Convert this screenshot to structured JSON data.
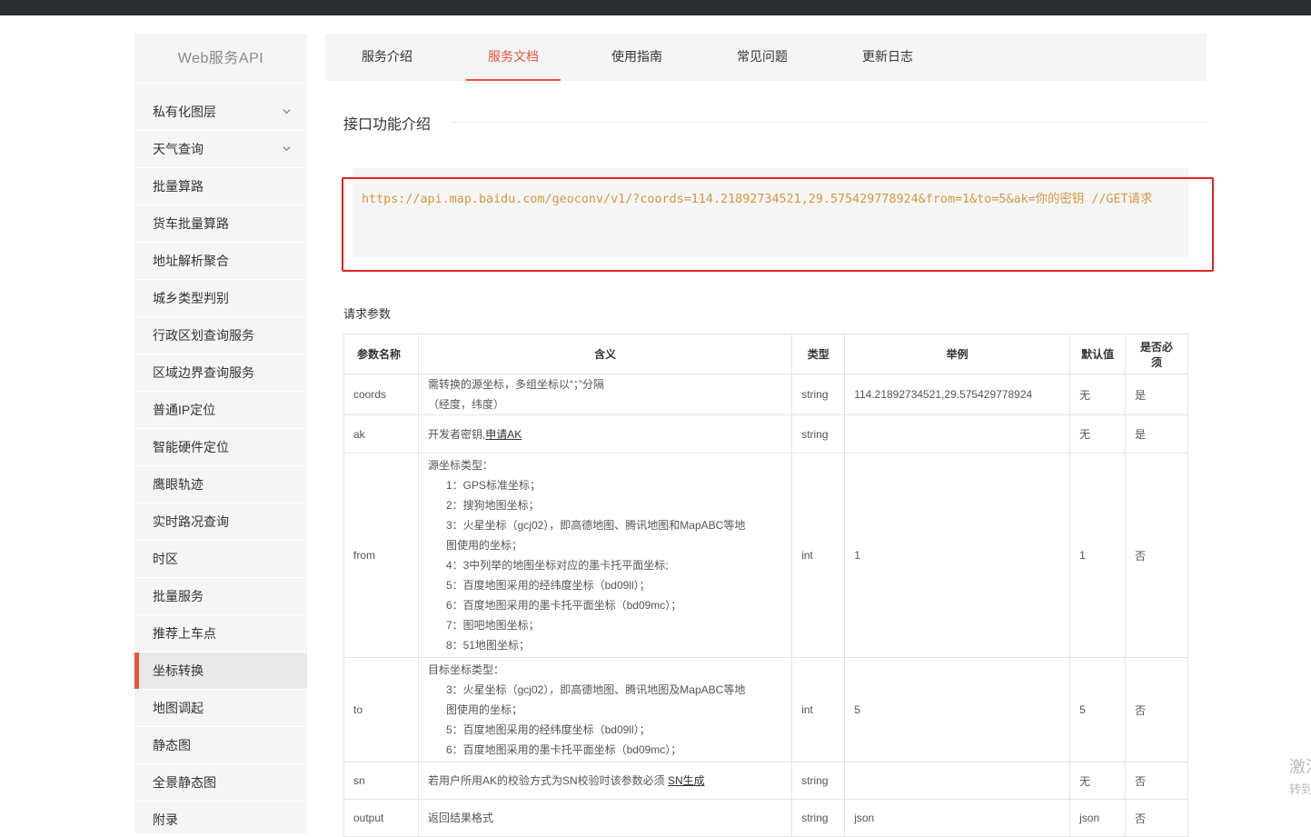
{
  "sidebar": {
    "title": "Web服务API",
    "items": [
      {
        "label": "私有化图层",
        "expandable": true
      },
      {
        "label": "天气查询",
        "expandable": true
      },
      {
        "label": "批量算路"
      },
      {
        "label": "货车批量算路"
      },
      {
        "label": "地址解析聚合"
      },
      {
        "label": "城乡类型判别"
      },
      {
        "label": "行政区划查询服务"
      },
      {
        "label": "区域边界查询服务"
      },
      {
        "label": "普通IP定位"
      },
      {
        "label": "智能硬件定位"
      },
      {
        "label": "鹰眼轨迹"
      },
      {
        "label": "实时路况查询"
      },
      {
        "label": "时区"
      },
      {
        "label": "批量服务"
      },
      {
        "label": "推荐上车点"
      },
      {
        "label": "坐标转换",
        "active": true
      },
      {
        "label": "地图调起"
      },
      {
        "label": "静态图"
      },
      {
        "label": "全景静态图"
      },
      {
        "label": "附录"
      }
    ],
    "active_color": "#e8533d"
  },
  "tabs": [
    {
      "label": "服务介绍"
    },
    {
      "label": "服务文档",
      "active": true
    },
    {
      "label": "使用指南"
    },
    {
      "label": "常见问题"
    },
    {
      "label": "更新日志"
    }
  ],
  "section": {
    "title": "接口功能介绍",
    "code": "https://api.map.baidu.com/geoconv/v1/?coords=114.21892734521,29.575429778924&from=1&to=5&ak=你的密钥 //GET请求"
  },
  "params": {
    "title": "请求参数",
    "headers": [
      "参数名称",
      "含义",
      "类型",
      "举例",
      "默认值",
      "是否必须"
    ],
    "rows": [
      {
        "name": "coords",
        "meaning": [
          "需转换的源坐标，多组坐标以“；”分隔",
          "（经度，纬度）"
        ],
        "type": "string",
        "example": "114.21892734521,29.575429778924",
        "default": "无",
        "required": "是"
      },
      {
        "name": "ak",
        "meaning_text": "开发者密钥,",
        "meaning_link": "申请AK",
        "type": "string",
        "example": "",
        "default": "无",
        "required": "是"
      },
      {
        "name": "from",
        "meaning_head": "源坐标类型：",
        "meaning": [
          "1：GPS标准坐标；",
          "2：搜狗地图坐标；",
          "3：火星坐标（gcj02），即高德地图、腾讯地图和MapABC等地",
          "图使用的坐标；",
          "4：3中列举的地图坐标对应的墨卡托平面坐标;",
          "5：百度地图采用的经纬度坐标（bd09ll）；",
          "6：百度地图采用的墨卡托平面坐标（bd09mc）；",
          "7：图吧地图坐标；",
          "8：51地图坐标；"
        ],
        "type": "int",
        "example": "1",
        "default": "1",
        "required": "否"
      },
      {
        "name": "to",
        "meaning_head": "目标坐标类型：",
        "meaning": [
          "3：火星坐标（gcj02），即高德地图、腾讯地图及MapABC等地",
          "图使用的坐标；",
          "5：百度地图采用的经纬度坐标（bd09ll）；",
          "6：百度地图采用的墨卡托平面坐标（bd09mc）；"
        ],
        "type": "int",
        "example": "5",
        "default": "5",
        "required": "否"
      },
      {
        "name": "sn",
        "meaning_text": "若用户所用AK的校验方式为SN校验时该参数必须 ",
        "meaning_link": "SN生成",
        "type": "string",
        "example": "",
        "default": "无",
        "required": "否"
      },
      {
        "name": "output",
        "meaning_text": "返回结果格式",
        "type": "string",
        "example": "json",
        "default": "json",
        "required": "否"
      }
    ]
  },
  "watermark": {
    "line1": "激活",
    "line2": "转到"
  }
}
